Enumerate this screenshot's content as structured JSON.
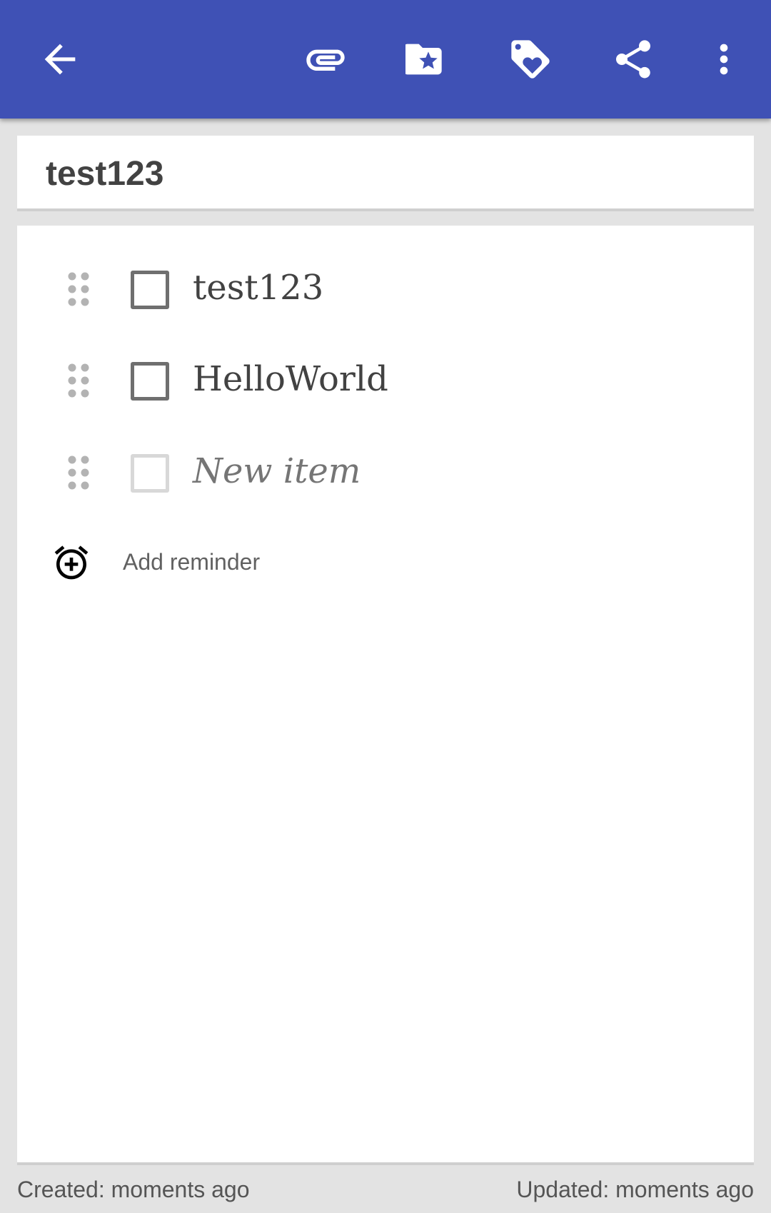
{
  "toolbar": {
    "background": "#3f51b5",
    "icons": {
      "back": "arrow-back-icon",
      "attach": "paperclip-icon",
      "category": "folder-star-icon",
      "tag": "tag-heart-icon",
      "share": "share-icon",
      "more": "more-vert-icon"
    }
  },
  "note": {
    "title": "test123",
    "items": [
      {
        "text": "test123",
        "checked": false
      },
      {
        "text": "HelloWorld",
        "checked": false
      }
    ],
    "new_item_placeholder": "New item"
  },
  "reminder": {
    "label": "Add reminder",
    "icon": "alarm-add-icon"
  },
  "footer": {
    "created": "Created: moments ago",
    "updated": "Updated: moments ago"
  }
}
